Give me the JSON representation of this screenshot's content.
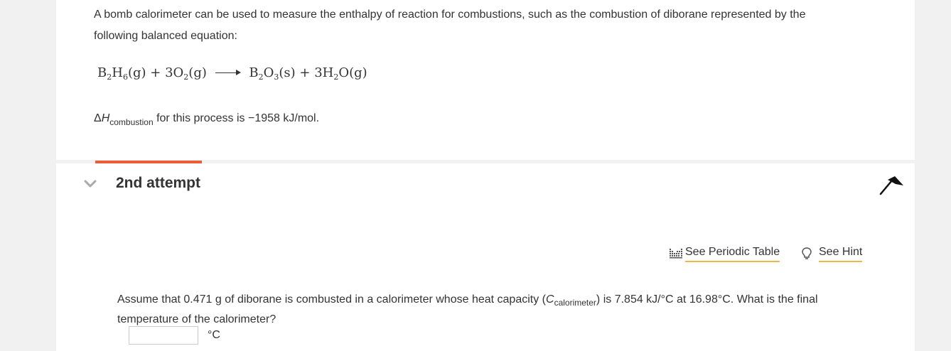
{
  "intro": {
    "line1": "A bomb calorimeter can be used to measure the enthalpy of reaction for combustions, such as the combustion of diborane represented by the",
    "line2": "following balanced equation:"
  },
  "equation": {
    "r1_coef": "",
    "r1_a": "B",
    "r1_a_sub": "2",
    "r1_b": "H",
    "r1_b_sub": "6",
    "r1_state": "(g)",
    "plus1": "+",
    "r2_coef": "3",
    "r2_a": "O",
    "r2_a_sub": "2",
    "r2_state": "(g)",
    "p1_a": "B",
    "p1_a_sub": "2",
    "p1_b": "O",
    "p1_b_sub": "3",
    "p1_state": "(s)",
    "plus2": "+",
    "p2_coef": "3",
    "p2_a": "H",
    "p2_a_sub": "2",
    "p2_b": "O",
    "p2_state": "(g)"
  },
  "enthalpy": {
    "delta": "Δ",
    "symbol": "H",
    "subscript": "combustion",
    "text": " for this process is −1958 kJ/mol."
  },
  "attempt": {
    "title": "2nd attempt"
  },
  "tools": {
    "periodic_label": "See Periodic Table",
    "hint_label": "See Hint"
  },
  "question": {
    "part1": "Assume that 0.471 g of diborane is combusted in a calorimeter whose heat capacity (",
    "c_symbol": "C",
    "c_sub": "calorimeter",
    "part2": ") is 7.854 kJ/°C at 16.98°C. What is the final temperature of the calorimeter?"
  },
  "answer": {
    "value": "",
    "unit": "°C"
  },
  "colors": {
    "progress": "#e95e38",
    "link_underline": "#f0b64a",
    "background": "#f1f1f1"
  },
  "icons": {
    "chevron": "chevron-down-icon",
    "flag": "flag-icon",
    "periodic": "periodic-table-icon",
    "hint": "lightbulb-icon"
  }
}
